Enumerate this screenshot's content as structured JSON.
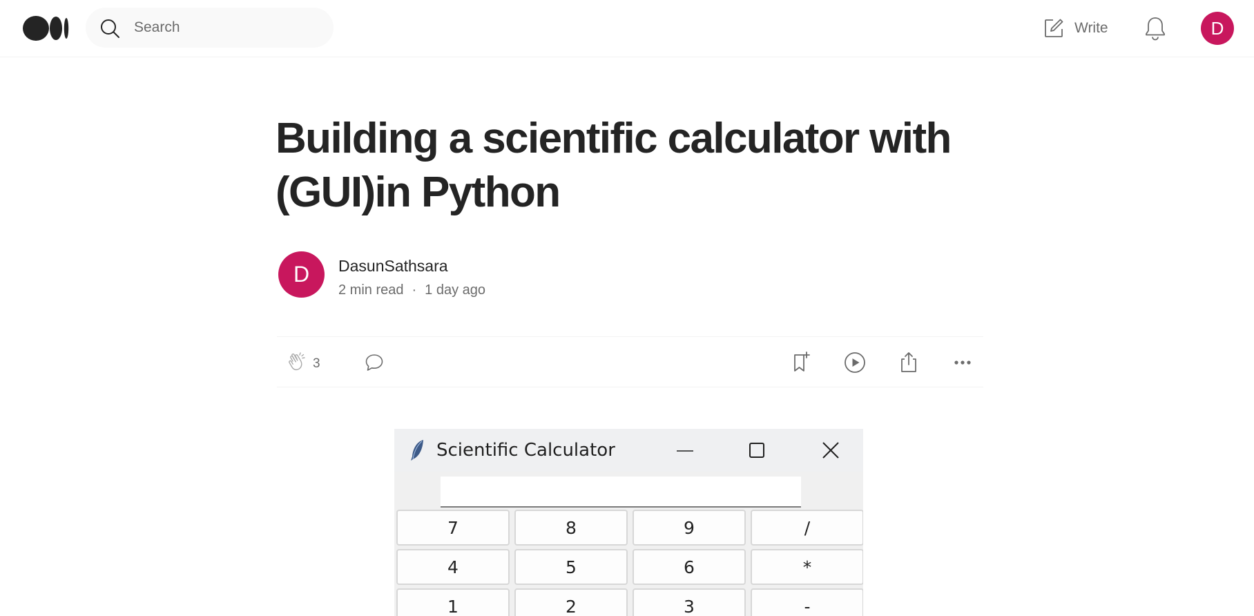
{
  "topbar": {
    "logo_icon": "medium-logo-icon",
    "search_placeholder": "Search",
    "write_label": "Write",
    "notifications_icon": "bell-icon",
    "user_avatar_initial": "D"
  },
  "article": {
    "title": "Building a scientific calculator with (GUI)in Python",
    "author": {
      "avatar_initial": "D",
      "name": "DasunSathsara"
    },
    "read_time": "2 min read",
    "separator": "·",
    "published": "1 day ago",
    "actions": {
      "clap_count": "3",
      "icons": [
        "clap-icon",
        "comment-icon",
        "bookmark-add-icon",
        "play-icon",
        "share-icon",
        "more-icon"
      ]
    }
  },
  "calculator_screenshot": {
    "window_title": "Scientific Calculator",
    "display_value": "",
    "keys": [
      [
        "7",
        "8",
        "9",
        "/"
      ],
      [
        "4",
        "5",
        "6",
        "*"
      ],
      [
        "1",
        "2",
        "3",
        "-"
      ]
    ]
  },
  "colors": {
    "avatar_bg": "#c8175d",
    "text_primary": "#242424",
    "text_secondary": "#6b6b6b",
    "search_bg": "#f9f9f9"
  }
}
